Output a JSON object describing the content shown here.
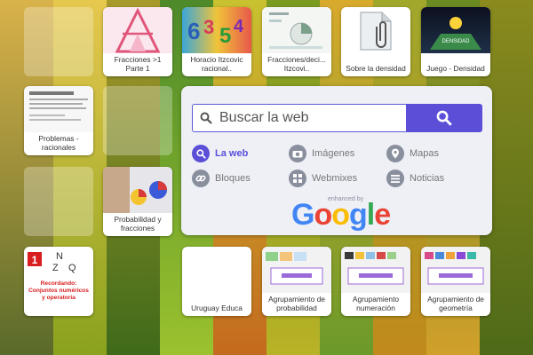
{
  "search": {
    "placeholder": "Buscar la web",
    "options": [
      "La web",
      "Imágenes",
      "Mapas",
      "Bloques",
      "Webmixes",
      "Noticias"
    ],
    "active_option": "La web",
    "enhanced_by": "enhanced by",
    "brand": "Google"
  },
  "tiles": [
    {
      "label": "Fracciones >1\nParte 1"
    },
    {
      "label": "Horacio Itzcovic\nracional.."
    },
    {
      "label": "Fracciones/deci...\nItzcovi.."
    },
    {
      "label": "Sobre la densidad"
    },
    {
      "label": "Juego - Densidad",
      "thumb_text": "DENSIDAD"
    },
    {
      "label": "Problemas -\nracionales"
    },
    {
      "label": "Probabilidad y\nfracciones"
    },
    {
      "label": "",
      "thumb_text": "Recordando:\nConjuntos numéricos\ny operatoria",
      "letters": [
        "1",
        "N",
        "Z",
        "Q"
      ]
    },
    {
      "label": "Uruguay Educa"
    },
    {
      "label": "Agrupamiento de\nprobabilidad"
    },
    {
      "label": "Agrupamiento\nnumeración"
    },
    {
      "label": "Agrupamiento de\ngeometría"
    }
  ],
  "colors": {
    "accent": "#5b4fd8",
    "google_blue": "#4285f4",
    "google_red": "#ea4335",
    "google_yellow": "#fbbc05",
    "google_green": "#34a853"
  }
}
